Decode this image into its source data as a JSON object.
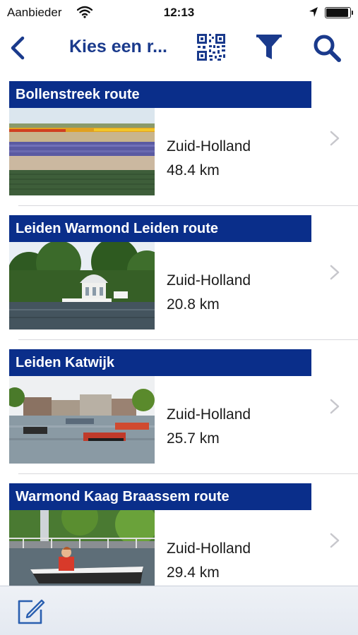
{
  "status_bar": {
    "carrier": "Aanbieder",
    "time": "12:13",
    "battery_level": 0.95
  },
  "nav": {
    "title": "Kies een r...",
    "icons": [
      "back-chevron-icon",
      "qr-code-icon",
      "filter-icon",
      "search-icon"
    ]
  },
  "routes": [
    {
      "title": "Bollenstreek route",
      "region": "Zuid-Holland",
      "distance": "48.4 km",
      "photo": "flower-fields"
    },
    {
      "title": "Leiden Warmond Leiden route",
      "region": "Zuid-Holland",
      "distance": "20.8 km",
      "photo": "lake-pavilion"
    },
    {
      "title": "Leiden Katwijk",
      "region": "Zuid-Holland",
      "distance": "25.7 km",
      "photo": "harbor-boats"
    },
    {
      "title": "Warmond Kaag Braassem route",
      "region": "Zuid-Holland",
      "distance": "29.4 km",
      "photo": "boat-canal"
    }
  ],
  "toolbar": {
    "icons": [
      "compose-icon"
    ]
  },
  "colors": {
    "accent": "#1a3a8c",
    "title_banner": "#0a2e8a",
    "chevron": "#c7c7cc",
    "separator": "#d8d8dc"
  }
}
